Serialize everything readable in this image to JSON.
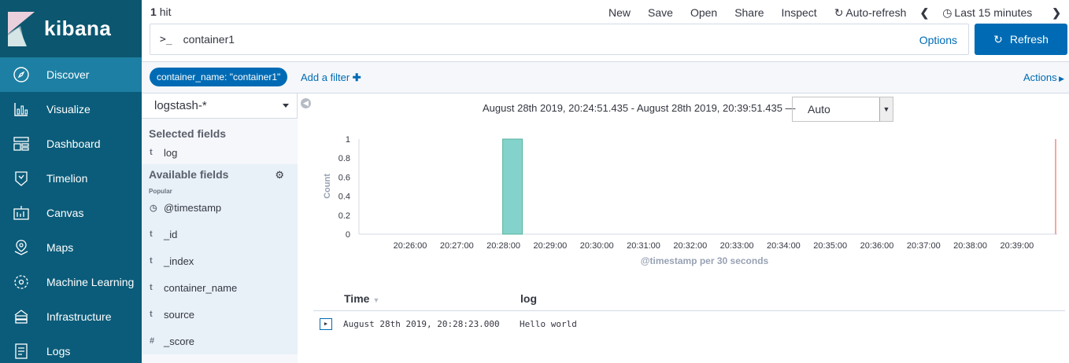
{
  "app": {
    "name": "kibana"
  },
  "sidebar": {
    "items": [
      {
        "label": "Discover",
        "icon": "compass-icon",
        "active": true
      },
      {
        "label": "Visualize",
        "icon": "chart-icon"
      },
      {
        "label": "Dashboard",
        "icon": "dashboard-icon"
      },
      {
        "label": "Timelion",
        "icon": "timelion-icon"
      },
      {
        "label": "Canvas",
        "icon": "canvas-icon"
      },
      {
        "label": "Maps",
        "icon": "maps-icon"
      },
      {
        "label": "Machine Learning",
        "icon": "ml-icon"
      },
      {
        "label": "Infrastructure",
        "icon": "infrastructure-icon"
      },
      {
        "label": "Logs",
        "icon": "logs-icon"
      }
    ]
  },
  "topbar": {
    "hits_count": "1",
    "hits_label": "hit",
    "menu": {
      "new": "New",
      "save": "Save",
      "open": "Open",
      "share": "Share",
      "inspect": "Inspect",
      "auto_refresh": "Auto-refresh",
      "time_range": "Last 15 minutes"
    },
    "query": {
      "prompt": ">_",
      "value": "container1",
      "options": "Options"
    },
    "refresh": "Refresh"
  },
  "filterbar": {
    "filter": "container_name: \"container1\"",
    "add_filter": "Add a filter",
    "actions": "Actions"
  },
  "fields": {
    "index_pattern": "logstash-*",
    "selected_heading": "Selected fields",
    "selected": [
      {
        "type": "t",
        "name": "log"
      }
    ],
    "available_heading": "Available fields",
    "popular_label": "Popular",
    "available": [
      {
        "type": "clock",
        "name": "@timestamp"
      },
      {
        "type": "t",
        "name": "_id"
      },
      {
        "type": "t",
        "name": "_index"
      },
      {
        "type": "t",
        "name": "container_name"
      },
      {
        "type": "t",
        "name": "source"
      },
      {
        "type": "#",
        "name": "_score"
      }
    ]
  },
  "main": {
    "time_range_text": "August 28th 2019, 20:24:51.435 - August 28th 2019, 20:39:51.435 —",
    "interval": "Auto"
  },
  "chart_data": {
    "type": "bar",
    "ylabel": "Count",
    "xlabel": "@timestamp per 30 seconds",
    "ylim": [
      0,
      1
    ],
    "yticks": [
      "0",
      "0.2",
      "0.4",
      "0.6",
      "0.8",
      "1"
    ],
    "xticks": [
      "20:26:00",
      "20:27:00",
      "20:28:00",
      "20:29:00",
      "20:30:00",
      "20:31:00",
      "20:32:00",
      "20:33:00",
      "20:34:00",
      "20:35:00",
      "20:36:00",
      "20:37:00",
      "20:38:00",
      "20:39:00"
    ],
    "bars": [
      {
        "x": "20:28:00",
        "value": 1
      }
    ],
    "bar_color": "#83d3cc",
    "bar_stroke": "#54b399",
    "now_marker_color": "#f08b86"
  },
  "documents": {
    "columns": {
      "time": "Time",
      "log": "log"
    },
    "rows": [
      {
        "time": "August 28th 2019, 20:28:23.000",
        "log": "Hello world"
      }
    ]
  },
  "colors": {
    "sidebar": "#0b5c7a",
    "sidebar_active": "#1d7fa3",
    "primary": "#006bb4"
  }
}
